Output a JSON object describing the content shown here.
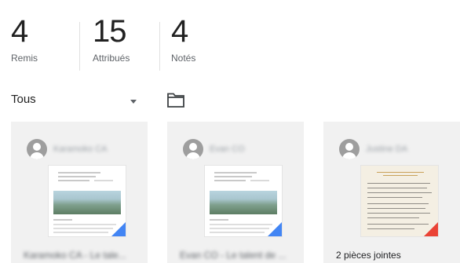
{
  "stats": [
    {
      "value": "4",
      "label": "Remis"
    },
    {
      "value": "15",
      "label": "Attribués"
    },
    {
      "value": "4",
      "label": "Notés"
    }
  ],
  "filter": {
    "selected": "Tous",
    "dropdown_icon": "arrow-drop-down-icon",
    "folder_icon": "folder-icon"
  },
  "cards": [
    {
      "student_name": "Karamoko CA",
      "caption": "Karamoko CA - Le tale...",
      "thumbnail": "document-thumbnail",
      "corner_color": "#4285f4"
    },
    {
      "student_name": "Evan CO",
      "caption": "Evan CO - Le talent de ...",
      "thumbnail": "document-thumbnail",
      "corner_color": "#4285f4"
    },
    {
      "student_name": "Justine DA",
      "caption": "2 pièces jointes",
      "thumbnail": "handwritten-thumbnail",
      "corner_color": "#ea4335"
    }
  ],
  "colors": {
    "card_background": "#f1f1f1",
    "secondary_text": "#5f6368",
    "divider": "#e0e0e0"
  }
}
